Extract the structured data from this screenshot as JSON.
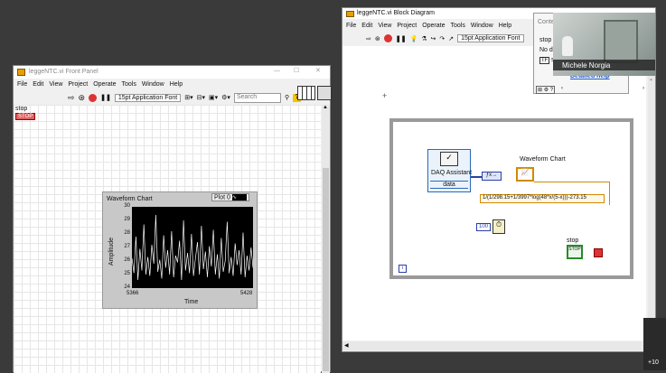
{
  "front_panel": {
    "title": "leggeNTC.vi Front Panel",
    "menu": [
      "File",
      "Edit",
      "View",
      "Project",
      "Operate",
      "Tools",
      "Window",
      "Help"
    ],
    "font_select": "15pt Application Font",
    "search_placeholder": "Search",
    "stop_label": "stop",
    "stop_button": "STOP",
    "chart_title": "Waveform Chart",
    "plot_legend": "Plot 0",
    "y_axis_label": "Amplitude",
    "x_axis_label": "Time",
    "y_ticks": [
      "30",
      "29",
      "28",
      "27",
      "26",
      "25",
      "24"
    ],
    "x_start": "5366",
    "x_end": "5428"
  },
  "block_diagram": {
    "title": "leggeNTC.vi Block Diagram",
    "menu": [
      "File",
      "Edit",
      "View",
      "Project",
      "Operate",
      "Tools",
      "Window",
      "Help"
    ],
    "font_select": "15pt Application Font",
    "daq_label": "DAQ Assistant",
    "daq_output": "data",
    "waveform_chart_label": "Waveform Chart",
    "formula": "1/(1/298.15+1/3997*log(48*x/(5-x)))-273.15",
    "wait_constant": "100",
    "stop_label": "stop",
    "loop_index": "i"
  },
  "context_popup": {
    "title": "Conte",
    "item1": "stop",
    "item2": "No de",
    "item3": "st",
    "detailed_help": "Detailed help"
  },
  "video": {
    "name": "Michele Norgia"
  },
  "participants_more": "+10",
  "chart_data": {
    "type": "line",
    "title": "Waveform Chart",
    "xlabel": "Time",
    "ylabel": "Amplitude",
    "xlim": [
      5366,
      5428
    ],
    "ylim": [
      24,
      30
    ],
    "series": [
      {
        "name": "Plot 0",
        "values": [
          26.2,
          25.1,
          27.8,
          24.6,
          26.9,
          25.3,
          28.7,
          25.0,
          26.3,
          24.9,
          27.2,
          25.8,
          29.4,
          25.2,
          26.1,
          24.7,
          27.9,
          25.5,
          26.8,
          25.0,
          28.2,
          24.8,
          26.4,
          25.9,
          27.5,
          24.6,
          29.0,
          25.3,
          26.6,
          25.1,
          28.0,
          24.9,
          26.2,
          27.4,
          25.0,
          28.6,
          25.4,
          26.7,
          24.8,
          27.1,
          25.6,
          28.3,
          25.0,
          26.5,
          24.7,
          27.7,
          25.2,
          26.0,
          28.9,
          25.1,
          26.3,
          24.9,
          27.3,
          25.7,
          26.8,
          25.0,
          28.1,
          24.8,
          26.4,
          25.3,
          27.0,
          25.5
        ]
      }
    ]
  }
}
